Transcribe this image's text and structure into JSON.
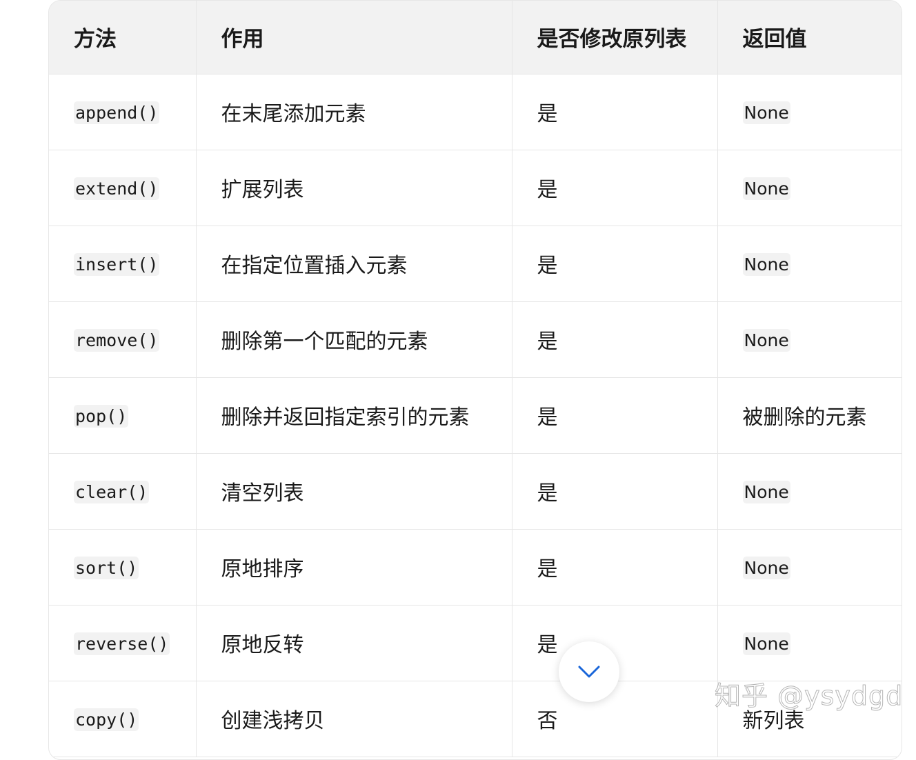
{
  "table": {
    "headers": [
      "方法",
      "作用",
      "是否修改原列表",
      "返回值"
    ],
    "rows": [
      {
        "method": "append()",
        "purpose": "在末尾添加元素",
        "modifies": "是",
        "returns": "None",
        "returns_code": true
      },
      {
        "method": "extend()",
        "purpose": "扩展列表",
        "modifies": "是",
        "returns": "None",
        "returns_code": true
      },
      {
        "method": "insert()",
        "purpose": "在指定位置插入元素",
        "modifies": "是",
        "returns": "None",
        "returns_code": true
      },
      {
        "method": "remove()",
        "purpose": "删除第一个匹配的元素",
        "modifies": "是",
        "returns": "None",
        "returns_code": true
      },
      {
        "method": "pop()",
        "purpose": "删除并返回指定索引的元素",
        "modifies": "是",
        "returns": "被删除的元素",
        "returns_code": false
      },
      {
        "method": "clear()",
        "purpose": "清空列表",
        "modifies": "是",
        "returns": "None",
        "returns_code": true
      },
      {
        "method": "sort()",
        "purpose": "原地排序",
        "modifies": "是",
        "returns": "None",
        "returns_code": true
      },
      {
        "method": "reverse()",
        "purpose": "原地反转",
        "modifies": "是",
        "returns": "None",
        "returns_code": true
      },
      {
        "method": "copy()",
        "purpose": "创建浅拷贝",
        "modifies": "否",
        "returns": "新列表",
        "returns_code": false
      }
    ]
  },
  "scroll_button": {
    "icon": "chevron-down-icon",
    "color": "#1a66d9"
  },
  "watermark": "知乎 @ysydgd",
  "colors": {
    "header_bg": "#f2f2f2",
    "border": "#e6e6e6",
    "code_bg": "#f2f2f2",
    "text": "#1a1a1a"
  }
}
